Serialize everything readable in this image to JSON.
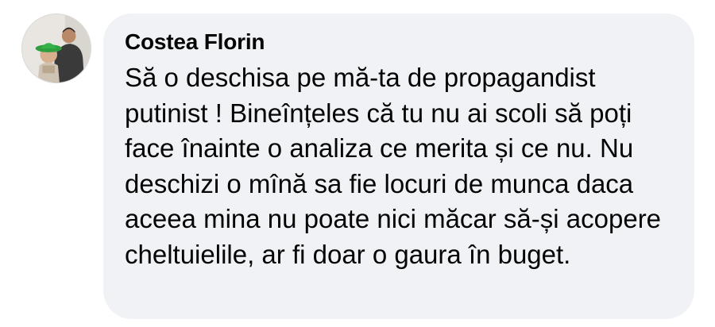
{
  "comment": {
    "author": "Costea Florin",
    "text": "Să o deschisa pe mă-ta de propagandist putinist ! Bineînțeles că tu nu ai scoli să poți face înainte o analiza ce merita și ce nu. Nu deschizi o mînă sa fie locuri de munca daca aceea mina nu poate nici măcar să-și acopere cheltuielile, ar fi doar o gaura în buget."
  },
  "colors": {
    "bubble_background": "#f0f2f5",
    "text": "#050505"
  },
  "icons": {
    "avatar": "profile-photo"
  }
}
